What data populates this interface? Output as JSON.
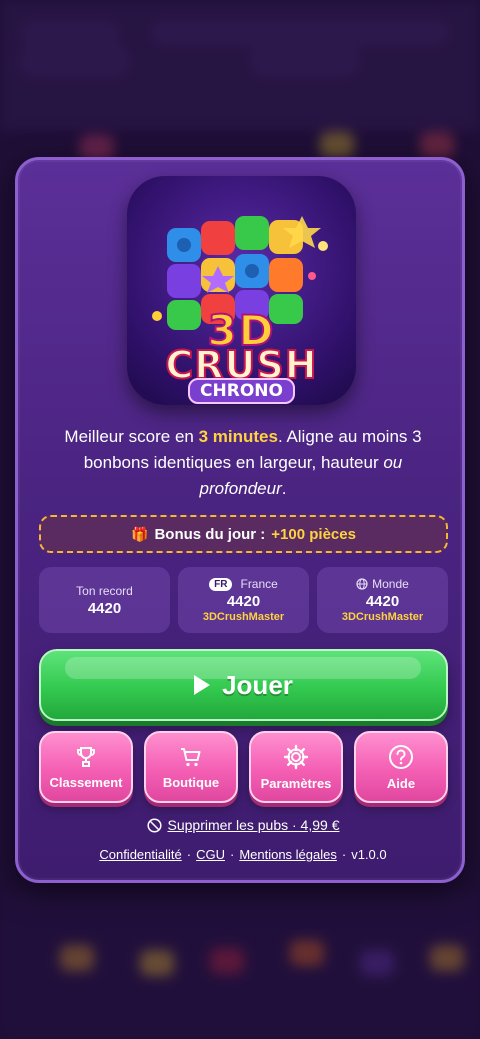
{
  "modal": {
    "logo": {
      "line1": "3D",
      "line2": "CRUSH",
      "line3": "CHRONO"
    },
    "description": {
      "part1": "Meilleur score en ",
      "highlight": "3 minutes",
      "part2": ". Aligne au moins 3 bonbons identiques en largeur, hauteur ",
      "italic1": "ou profondeur",
      "part3": "."
    },
    "bonus": {
      "label": "Bonus du jour :",
      "amount": "+100 pièces"
    },
    "stats": [
      {
        "label": "Ton record",
        "value": "4420",
        "player": ""
      },
      {
        "badge": "FR",
        "label": "France",
        "value": "4420",
        "player": "3DCrushMaster"
      },
      {
        "label": "Monde",
        "value": "4420",
        "player": "3DCrushMaster"
      }
    ],
    "play_label": "Jouer",
    "actions": [
      {
        "label": "Classement",
        "icon": "trophy-icon"
      },
      {
        "label": "Boutique",
        "icon": "cart-icon"
      },
      {
        "label": "Paramètres",
        "icon": "gear-icon"
      },
      {
        "label": "Aide",
        "icon": "help-icon"
      }
    ],
    "remove_ads": "Supprimer les pubs · 4,99 €",
    "footer": {
      "privacy": "Confidentialité",
      "terms": "CGU",
      "legal": "Mentions légales",
      "version": "v1.0.0"
    }
  }
}
